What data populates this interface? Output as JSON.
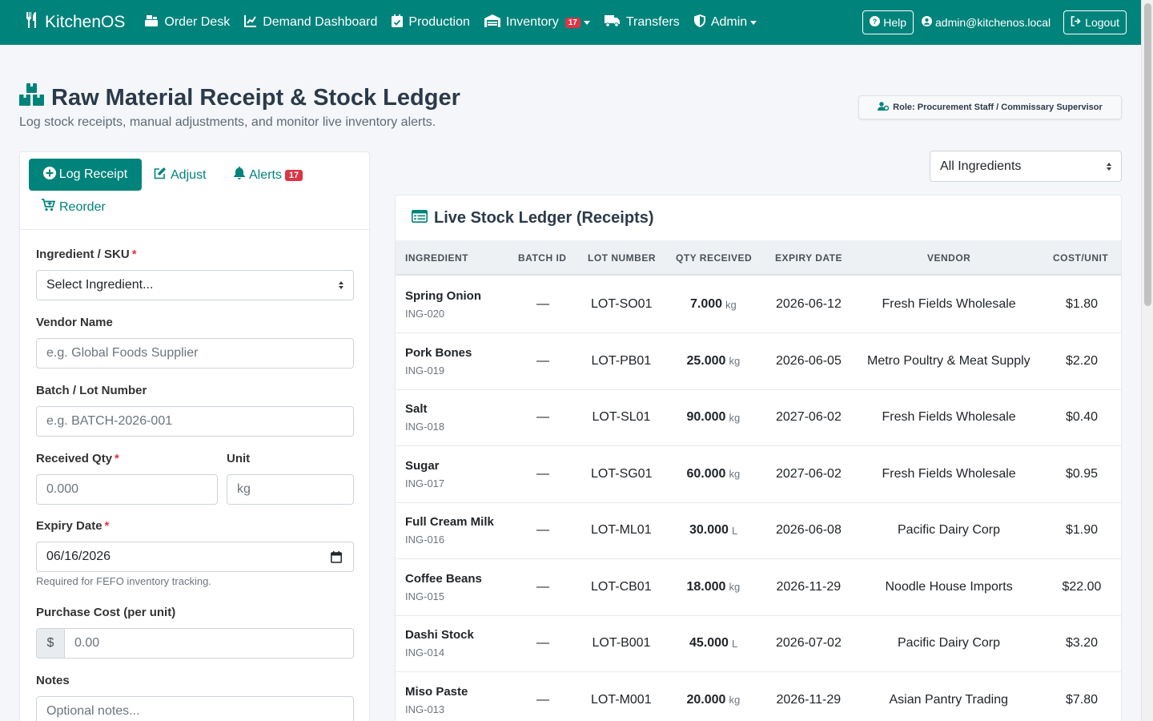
{
  "nav": {
    "brand": "KitchenOS",
    "items": [
      {
        "label": "Order Desk",
        "icon": "cash-register-icon"
      },
      {
        "label": "Demand Dashboard",
        "icon": "chart-line-icon"
      },
      {
        "label": "Production",
        "icon": "calendar-check-icon"
      },
      {
        "label": "Inventory",
        "icon": "warehouse-icon",
        "badge": "17"
      },
      {
        "label": "Transfers",
        "icon": "truck-icon"
      },
      {
        "label": "Admin",
        "icon": "shield-icon"
      }
    ],
    "help": "Help",
    "user": "admin@kitchenos.local",
    "logout": "Logout"
  },
  "header": {
    "title": "Raw Material Receipt & Stock Ledger",
    "subtitle": "Log stock receipts, manual adjustments, and monitor live inventory alerts.",
    "role": "Role: Procurement Staff / Commissary Supervisor"
  },
  "tabs": {
    "log_receipt": "Log Receipt",
    "adjust": "Adjust",
    "alerts": "Alerts",
    "alerts_badge": "17",
    "reorder": "Reorder"
  },
  "form": {
    "ingredient_label": "Ingredient / SKU",
    "ingredient_value": "Select Ingredient...",
    "vendor_label": "Vendor Name",
    "vendor_placeholder": "e.g. Global Foods Supplier",
    "batch_label": "Batch / Lot Number",
    "batch_placeholder": "e.g. BATCH-2026-001",
    "qty_label": "Received Qty",
    "qty_placeholder": "0.000",
    "unit_label": "Unit",
    "unit_value": "kg",
    "expiry_label": "Expiry Date",
    "expiry_value": "06/16/2026",
    "expiry_help": "Required for FEFO inventory tracking.",
    "cost_label": "Purchase Cost (per unit)",
    "cost_prefix": "$",
    "cost_placeholder": "0.00",
    "notes_label": "Notes",
    "notes_placeholder": "Optional notes...",
    "required_mark": "*"
  },
  "filter": {
    "value": "All Ingredients"
  },
  "ledger": {
    "title": "Live Stock Ledger (Receipts)",
    "columns": [
      "INGREDIENT",
      "BATCH ID",
      "LOT NUMBER",
      "QTY RECEIVED",
      "EXPIRY DATE",
      "VENDOR",
      "COST/UNIT"
    ],
    "rows": [
      {
        "name": "Spring Onion",
        "code": "ING-020",
        "batch": "—",
        "lot": "LOT-SO01",
        "qty": "7.000",
        "unit": "kg",
        "expiry": "2026-06-12",
        "vendor": "Fresh Fields Wholesale",
        "cost": "$1.80"
      },
      {
        "name": "Pork Bones",
        "code": "ING-019",
        "batch": "—",
        "lot": "LOT-PB01",
        "qty": "25.000",
        "unit": "kg",
        "expiry": "2026-06-05",
        "vendor": "Metro Poultry & Meat Supply",
        "cost": "$2.20"
      },
      {
        "name": "Salt",
        "code": "ING-018",
        "batch": "—",
        "lot": "LOT-SL01",
        "qty": "90.000",
        "unit": "kg",
        "expiry": "2027-06-02",
        "vendor": "Fresh Fields Wholesale",
        "cost": "$0.40"
      },
      {
        "name": "Sugar",
        "code": "ING-017",
        "batch": "—",
        "lot": "LOT-SG01",
        "qty": "60.000",
        "unit": "kg",
        "expiry": "2027-06-02",
        "vendor": "Fresh Fields Wholesale",
        "cost": "$0.95"
      },
      {
        "name": "Full Cream Milk",
        "code": "ING-016",
        "batch": "—",
        "lot": "LOT-ML01",
        "qty": "30.000",
        "unit": "L",
        "expiry": "2026-06-08",
        "vendor": "Pacific Dairy Corp",
        "cost": "$1.90"
      },
      {
        "name": "Coffee Beans",
        "code": "ING-015",
        "batch": "—",
        "lot": "LOT-CB01",
        "qty": "18.000",
        "unit": "kg",
        "expiry": "2026-11-29",
        "vendor": "Noodle House Imports",
        "cost": "$22.00"
      },
      {
        "name": "Dashi Stock",
        "code": "ING-014",
        "batch": "—",
        "lot": "LOT-B001",
        "qty": "45.000",
        "unit": "L",
        "expiry": "2026-07-02",
        "vendor": "Pacific Dairy Corp",
        "cost": "$3.20"
      },
      {
        "name": "Miso Paste",
        "code": "ING-013",
        "batch": "—",
        "lot": "LOT-M001",
        "qty": "20.000",
        "unit": "kg",
        "expiry": "2026-11-29",
        "vendor": "Asian Pantry Trading",
        "cost": "$7.80"
      }
    ]
  },
  "colors": {
    "brand": "#00837b",
    "danger": "#dc3545"
  }
}
